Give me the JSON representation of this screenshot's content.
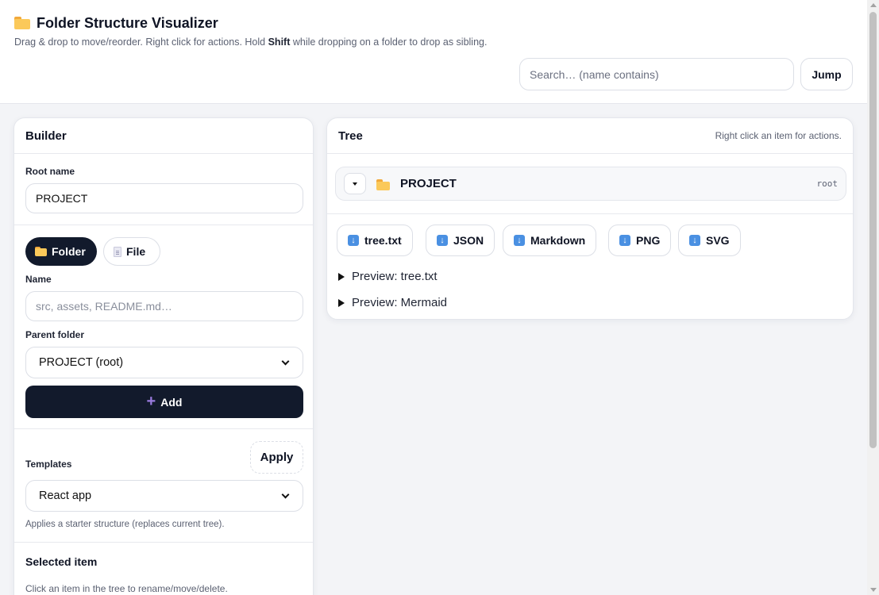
{
  "header": {
    "title": "Folder Structure Visualizer",
    "subtitle_pre": "Drag & drop to move/reorder. Right click for actions. Hold ",
    "subtitle_bold": "Shift",
    "subtitle_post": " while dropping on a folder to drop as sibling.",
    "search_placeholder": "Search… (name contains)",
    "search_value": "",
    "jump_label": "Jump"
  },
  "builder": {
    "title": "Builder",
    "root_name_label": "Root name",
    "root_name_value": "PROJECT",
    "type_folder_label": "Folder",
    "type_file_label": "File",
    "type_selected": "Folder",
    "name_label": "Name",
    "name_placeholder": "src, assets, README.md…",
    "name_value": "",
    "parent_label": "Parent folder",
    "parent_selected": "PROJECT (root)",
    "add_label": "Add",
    "templates_label": "Templates",
    "apply_label": "Apply",
    "template_selected": "React app",
    "templates_help": "Applies a starter structure (replaces current tree).",
    "selected_title": "Selected item",
    "selected_help": "Click an item in the tree to rename/move/delete."
  },
  "tree": {
    "title": "Tree",
    "hint": "Right click an item for actions.",
    "root_name": "PROJECT",
    "root_tag": "root",
    "exports": [
      "tree.txt",
      "JSON",
      "Markdown",
      "PNG",
      "SVG"
    ],
    "preview_tree": "Preview: tree.txt",
    "preview_mermaid": "Preview: Mermaid"
  },
  "icons": {
    "folder": "folder-icon",
    "file": "file-icon",
    "download": "download-icon",
    "plus": "plus-icon",
    "caret": "caret-down-icon"
  },
  "colors": {
    "primary_dark": "#121a2c",
    "accent_plus": "#9b7ce0",
    "folder_yellow": "#fbc95a",
    "download_blue": "#4a90e2",
    "background": "#f3f4f7"
  }
}
